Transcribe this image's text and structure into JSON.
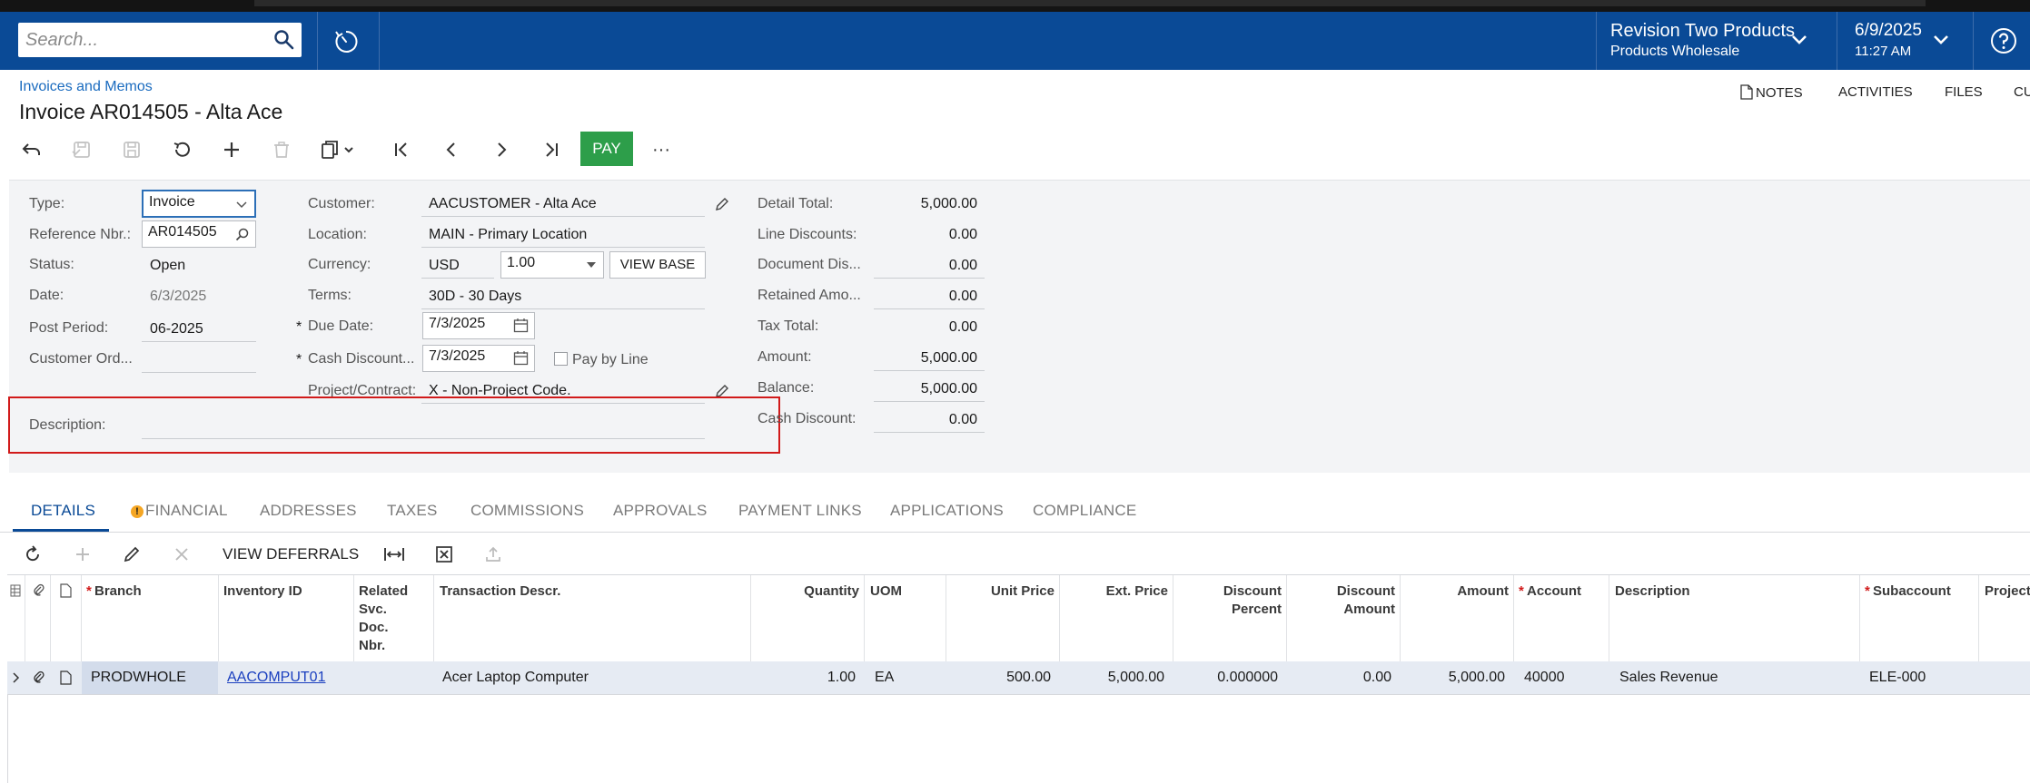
{
  "header": {
    "search_placeholder": "Search...",
    "company_name": "Revision Two Products",
    "company_branch": "Products Wholesale",
    "date": "6/9/2025",
    "time": "11:27 AM"
  },
  "page": {
    "breadcrumb": "Invoices and Memos",
    "title": "Invoice AR014505 - Alta Ace",
    "top_actions": [
      "NOTES",
      "ACTIVITIES",
      "FILES",
      "CU"
    ]
  },
  "toolbar": {
    "pay_label": "PAY",
    "more_label": "···"
  },
  "form": {
    "type_label": "Type:",
    "type_value": "Invoice",
    "ref_label": "Reference Nbr.:",
    "ref_value": "AR014505",
    "status_label": "Status:",
    "status_value": "Open",
    "date_label": "Date:",
    "date_value": "6/3/2025",
    "post_period_label": "Post Period:",
    "post_period_value": "06-2025",
    "customer_order_label": "Customer Ord...",
    "customer_order_value": "",
    "customer_label": "Customer:",
    "customer_value": "AACUSTOMER - Alta Ace",
    "location_label": "Location:",
    "location_value": "MAIN - Primary Location",
    "currency_label": "Currency:",
    "currency_value": "USD",
    "rate_value": "1.00",
    "view_base_label": "VIEW BASE",
    "terms_label": "Terms:",
    "terms_value": "30D - 30 Days",
    "due_date_label": "Due Date:",
    "due_date_value": "7/3/2025",
    "cash_discount_date_label": "Cash Discount...",
    "cash_discount_date_value": "7/3/2025",
    "pay_by_line_label": "Pay by Line",
    "project_label": "Project/Contract:",
    "project_value": "X - Non-Project Code.",
    "description_label": "Description:",
    "description_value": "",
    "required_mark": "*"
  },
  "totals": [
    {
      "label": "Detail Total:",
      "value": "5,000.00"
    },
    {
      "label": "Line Discounts:",
      "value": "0.00"
    },
    {
      "label": "Document Dis...",
      "value": "0.00"
    },
    {
      "label": "Retained Amo...",
      "value": "0.00"
    },
    {
      "label": "Tax Total:",
      "value": "0.00"
    },
    {
      "label": "Amount:",
      "value": "5,000.00"
    },
    {
      "label": "Balance:",
      "value": "5,000.00"
    },
    {
      "label": "Cash Discount:",
      "value": "0.00"
    }
  ],
  "tabs": [
    "DETAILS",
    "FINANCIAL",
    "ADDRESSES",
    "TAXES",
    "COMMISSIONS",
    "APPROVALS",
    "PAYMENT LINKS",
    "APPLICATIONS",
    "COMPLIANCE"
  ],
  "grid_toolbar": {
    "view_deferrals_label": "VIEW DEFERRALS"
  },
  "grid": {
    "required_mark": "*",
    "columns": {
      "branch": "Branch",
      "inventory_id": "Inventory ID",
      "related_1": "Related",
      "related_2": "Svc.",
      "related_3": "Doc.",
      "related_4": "Nbr.",
      "transaction_descr": "Transaction Descr.",
      "quantity": "Quantity",
      "uom": "UOM",
      "unit_price": "Unit Price",
      "ext_price": "Ext. Price",
      "discount_percent_1": "Discount",
      "discount_percent_2": "Percent",
      "discount_amount_1": "Discount",
      "discount_amount_2": "Amount",
      "amount": "Amount",
      "account": "Account",
      "description": "Description",
      "subaccount": "Subaccount",
      "project": "Project"
    },
    "rows": [
      {
        "branch": "PRODWHOLE",
        "inventory_id": "AACOMPUT01",
        "transaction_descr": "Acer Laptop Computer",
        "quantity": "1.00",
        "uom": "EA",
        "unit_price": "500.00",
        "ext_price": "5,000.00",
        "discount_percent": "0.000000",
        "discount_amount": "0.00",
        "amount": "5,000.00",
        "account": "40000",
        "description": "Sales Revenue",
        "subaccount": "ELE-000"
      }
    ]
  },
  "colors": {
    "header_bg": "#0a4a96",
    "pay_button": "#2d9e4a",
    "highlight_box": "#d11a1a",
    "link": "#1a6bbf",
    "warning": "#f5a623"
  }
}
